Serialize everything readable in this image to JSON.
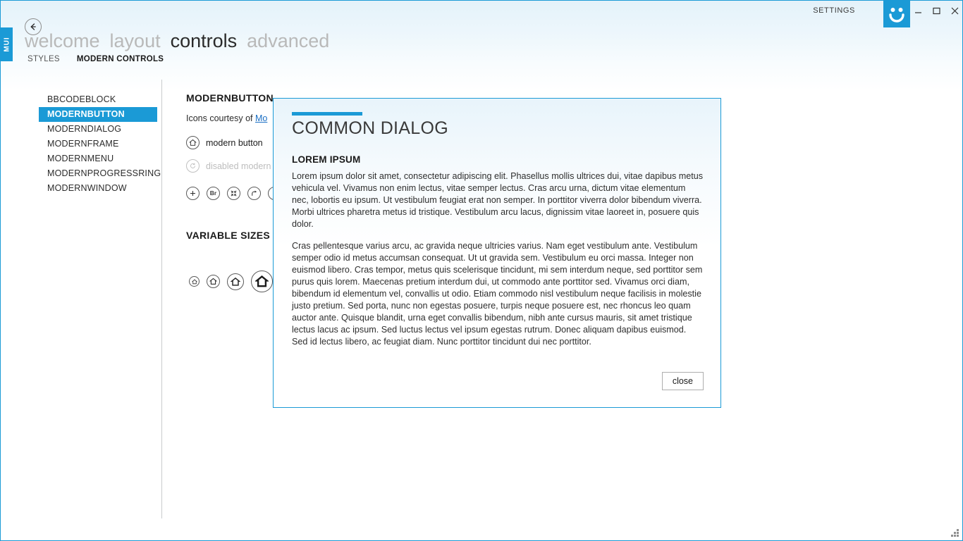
{
  "window": {
    "settings_label": "SETTINGS",
    "logo_icon": "smiley-face-icon",
    "minimize_label": "–",
    "maximize_label": "☐",
    "close_label": "×",
    "accent_color": "#1b9ad6",
    "border_color": "#1b9ad6"
  },
  "side_tab": {
    "label": "MUI"
  },
  "back_button": {
    "icon": "arrow-left-icon"
  },
  "main_nav": {
    "tabs": [
      {
        "label": "welcome",
        "active": false
      },
      {
        "label": "layout",
        "active": false
      },
      {
        "label": "controls",
        "active": true
      },
      {
        "label": "advanced",
        "active": false
      }
    ]
  },
  "sub_nav": {
    "items": [
      {
        "label": "STYLES",
        "active": false
      },
      {
        "label": "MODERN CONTROLS",
        "active": true
      }
    ]
  },
  "sidebar": {
    "items": [
      {
        "label": "BBCODEBLOCK",
        "selected": false
      },
      {
        "label": "MODERNBUTTON",
        "selected": true
      },
      {
        "label": "MODERNDIALOG",
        "selected": false
      },
      {
        "label": "MODERNFRAME",
        "selected": false
      },
      {
        "label": "MODERNMENU",
        "selected": false
      },
      {
        "label": "MODERNPROGRESSRING",
        "selected": false
      },
      {
        "label": "MODERNWINDOW",
        "selected": false
      }
    ]
  },
  "content": {
    "title": "MODERNBUTTON",
    "credit_prefix": "Icons courtesy of ",
    "credit_link": "Mo",
    "modern_button": {
      "icon": "home-icon",
      "label": "modern button"
    },
    "disabled_button": {
      "icon": "refresh-icon",
      "label": "disabled modern"
    },
    "icon_buttons": [
      {
        "icon": "plus-icon",
        "label": "+"
      },
      {
        "icon": "br-text-icon",
        "label": "Br"
      },
      {
        "icon": "collapse-icon",
        "label": ""
      },
      {
        "icon": "arrow-forward-icon",
        "label": ""
      },
      {
        "icon": "arrow-down-icon",
        "label": ""
      }
    ],
    "variable_sizes_title": "VARIABLE SIZES",
    "size_buttons": [
      {
        "icon": "home-icon",
        "size": 15
      },
      {
        "icon": "home-icon",
        "size": 19
      },
      {
        "icon": "home-icon",
        "size": 24
      },
      {
        "icon": "home-icon",
        "size": 31
      }
    ]
  },
  "dialog": {
    "title": "COMMON DIALOG",
    "subtitle": "LOREM IPSUM",
    "paragraphs": [
      "Lorem ipsum dolor sit amet, consectetur adipiscing elit. Phasellus mollis ultrices dui, vitae dapibus metus vehicula vel. Vivamus non enim lectus, vitae semper lectus. Cras arcu urna, dictum vitae elementum nec, lobortis eu ipsum. Ut vestibulum feugiat erat non semper. In porttitor viverra dolor bibendum viverra. Morbi ultrices pharetra metus id tristique. Vestibulum arcu lacus, dignissim vitae laoreet in, posuere quis dolor.",
      "Cras pellentesque varius arcu, ac gravida neque ultricies varius. Nam eget vestibulum ante. Vestibulum semper odio id metus accumsan consequat. Ut ut gravida sem. Vestibulum eu orci massa. Integer non euismod libero. Cras tempor, metus quis scelerisque tincidunt, mi sem interdum neque, sed porttitor sem purus quis lorem. Maecenas pretium interdum dui, ut commodo ante porttitor sed. Vivamus orci diam, bibendum id elementum vel, convallis ut odio. Etiam commodo nisl vestibulum neque facilisis in molestie justo pretium. Sed porta, nunc non egestas posuere, turpis neque posuere est, nec rhoncus leo quam auctor ante. Quisque blandit, urna eget convallis bibendum, nibh ante cursus mauris, sit amet tristique lectus lacus ac ipsum. Sed luctus lectus vel ipsum egestas rutrum. Donec aliquam dapibus euismod. Sed id lectus libero, ac feugiat diam. Nunc porttitor tincidunt dui nec porttitor."
    ],
    "close_label": "close",
    "accent_color": "#1b9ad6"
  },
  "resize_grip": {
    "icon": "resize-grip-icon"
  }
}
